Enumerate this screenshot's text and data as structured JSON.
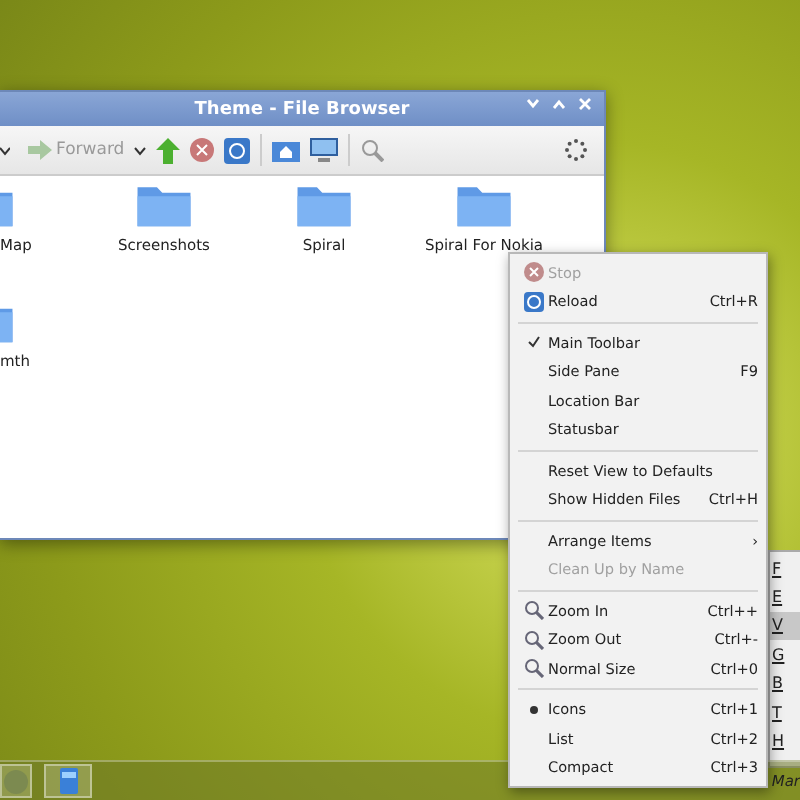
{
  "window": {
    "title": "Theme - File Browser"
  },
  "toolbar": {
    "forward_label": "Forward"
  },
  "files": [
    {
      "name": "Map"
    },
    {
      "name": "Screenshots"
    },
    {
      "name": "Spiral"
    },
    {
      "name": "Spiral For Nokia"
    },
    {
      "name": "mth"
    }
  ],
  "context_menu": {
    "items": [
      {
        "kind": "stop",
        "label": "Stop",
        "disabled": true
      },
      {
        "kind": "reload",
        "label": "Reload",
        "shortcut": "Ctrl+R",
        "disabled": false
      },
      {
        "kind": "separator"
      },
      {
        "kind": "check",
        "label": "Main Toolbar",
        "checked": true
      },
      {
        "kind": "check",
        "label": "Side Pane",
        "shortcut": "F9",
        "checked": false
      },
      {
        "kind": "check",
        "label": "Location Bar",
        "checked": false
      },
      {
        "kind": "check",
        "label": "Statusbar",
        "checked": false
      },
      {
        "kind": "separator"
      },
      {
        "kind": "plain",
        "label": "Reset View to Defaults",
        "disabled": false
      },
      {
        "kind": "plain",
        "label": "Show Hidden Files",
        "shortcut": "Ctrl+H",
        "disabled": false
      },
      {
        "kind": "separator"
      },
      {
        "kind": "submenu",
        "label": "Arrange Items",
        "shortcut": "›"
      },
      {
        "kind": "plain",
        "label": "Clean Up by Name",
        "disabled": true
      },
      {
        "kind": "separator"
      },
      {
        "kind": "zoom",
        "label": "Zoom In",
        "shortcut": "Ctrl++",
        "disabled": false
      },
      {
        "kind": "zoom",
        "label": "Zoom Out",
        "shortcut": "Ctrl+-",
        "disabled": false
      },
      {
        "kind": "zoom",
        "label": "Normal Size",
        "shortcut": "Ctrl+0",
        "disabled": false
      },
      {
        "kind": "separator"
      },
      {
        "kind": "radio",
        "label": "Icons",
        "shortcut": "Ctrl+1",
        "selected": true
      },
      {
        "kind": "radio",
        "label": "List",
        "shortcut": "Ctrl+2",
        "selected": false
      },
      {
        "kind": "radio",
        "label": "Compact",
        "shortcut": "Ctrl+3",
        "selected": false
      }
    ]
  },
  "menubar_menu": {
    "items": [
      {
        "label": "F",
        "selected": false
      },
      {
        "label": "E",
        "selected": false
      },
      {
        "label": "V",
        "selected": true
      },
      {
        "label": "G",
        "selected": false
      },
      {
        "label": "B",
        "selected": false
      },
      {
        "label": "T",
        "selected": false
      },
      {
        "label": "H",
        "selected": false
      }
    ]
  },
  "taskbar": {
    "tray_text": "Mar"
  }
}
